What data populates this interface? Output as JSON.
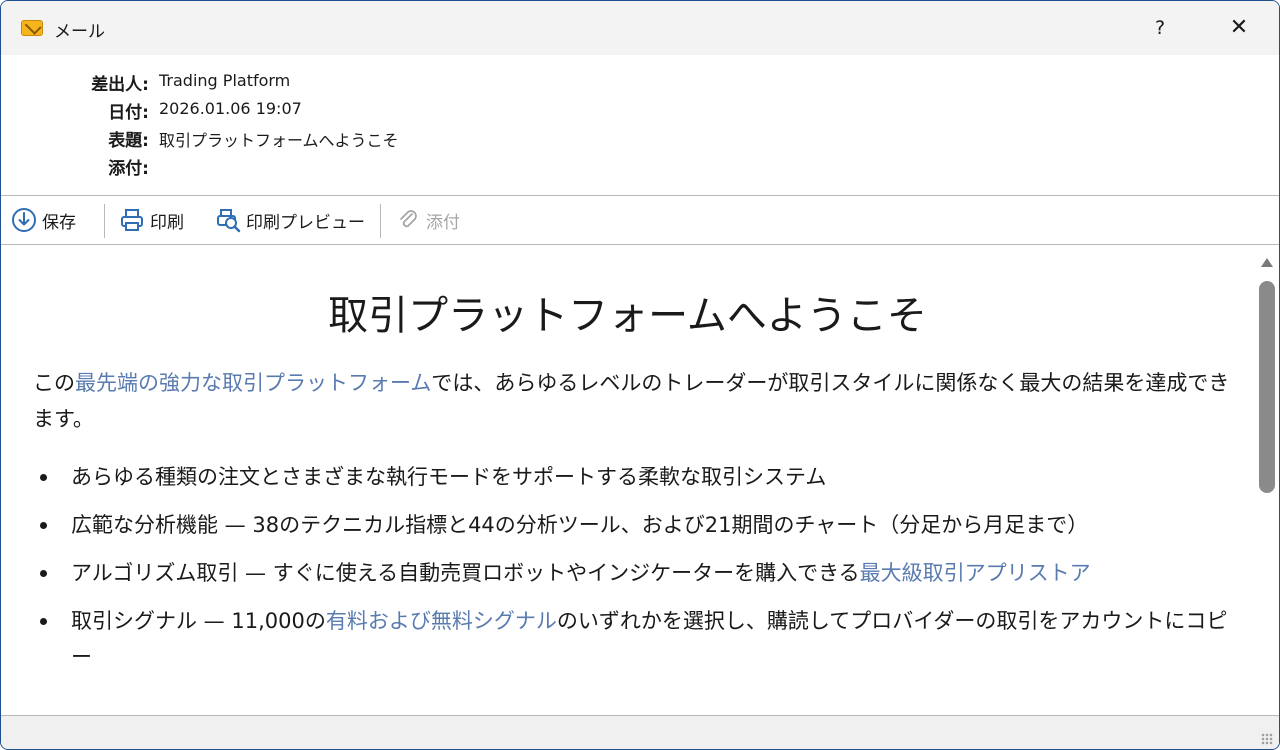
{
  "window": {
    "title": "メール",
    "help_label": "?",
    "close_label": "✕"
  },
  "header": {
    "fields": [
      {
        "label": "差出人:",
        "value": "Trading Platform"
      },
      {
        "label": "日付:",
        "value": "2026.01.06 19:07"
      },
      {
        "label": "表題:",
        "value": "取引プラットフォームへようこそ"
      },
      {
        "label": "添付:",
        "value": ""
      }
    ]
  },
  "toolbar": {
    "save_label": "保存",
    "print_label": "印刷",
    "preview_label": "印刷プレビュー",
    "attach_label": "添付"
  },
  "body": {
    "title": "取引プラットフォームへようこそ",
    "intro_prefix": "この",
    "intro_link": "最先端の強力な取引プラットフォーム",
    "intro_suffix": "では、あらゆるレベルのトレーダーが取引スタイルに関係なく最大の結果を達成できます。",
    "bullets": [
      {
        "text": "あらゆる種類の注文とさまざまな執行モードをサポートする柔軟な取引システム"
      },
      {
        "text": "広範な分析機能 — 38のテクニカル指標と44の分析ツール、および21期間のチャート（分足から月足まで）"
      },
      {
        "prefix": "アルゴリズム取引 — すぐに使える自動売買ロボットやインジケーターを購入できる",
        "link": "最大級取引アプリストア",
        "suffix": ""
      },
      {
        "prefix": "取引シグナル — 11,000の",
        "link": "有料および無料シグナル",
        "suffix": "のいずれかを選択し、購読してプロバイダーの取引をアカウントにコピー"
      }
    ]
  },
  "colors": {
    "link": "#5a7bb0",
    "window_border": "#1f4f8f",
    "icon_blue": "#2f6db5"
  },
  "icons": {
    "app": "mail-envelope-icon",
    "save": "download-circle-icon",
    "print": "printer-icon",
    "preview": "print-preview-icon",
    "attach": "paperclip-icon"
  }
}
